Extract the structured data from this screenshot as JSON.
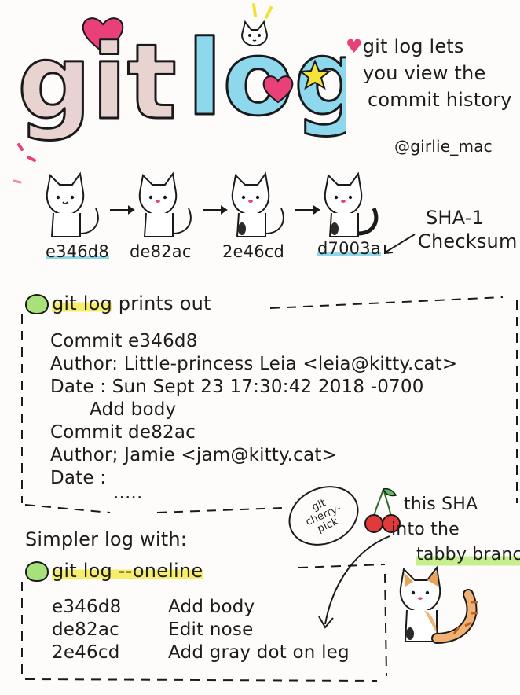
{
  "title": {
    "word1": "git",
    "word2": "log"
  },
  "intro": {
    "line1": "git log lets",
    "line2": "you view the",
    "line3": "commit history"
  },
  "author_handle": "@girlie_mac",
  "commits_row": {
    "shas": [
      "e346d8",
      "de82ac",
      "2e46cd",
      "d7003a"
    ],
    "checksum_label_line1": "SHA-1",
    "checksum_label_line2": "Checksum"
  },
  "full_log": {
    "header_command": "git log",
    "header_rest": "prints out",
    "lines": [
      "Commit e346d8",
      "Author: Little-princess Leia <leia@kitty.cat>",
      "Date : Sun Sept 23  17:30:42  2018 -0700",
      "Add body",
      "Commit de82ac",
      "Author; Jamie <jam@kitty.cat>",
      "Date   :",
      "....."
    ]
  },
  "cherry_pick": {
    "stamp_line1": "git",
    "stamp_line2": "cherry-",
    "stamp_line3": "pick",
    "note_line1": "this SHA",
    "note_line2": "into the",
    "note_line3": "tabby branch"
  },
  "oneline": {
    "intro": "Simpler log with:",
    "command": "git log --oneline",
    "entries": [
      {
        "sha": "e346d8",
        "message": "Add body"
      },
      {
        "sha": "de82ac",
        "message": "Edit nose"
      },
      {
        "sha": "2e46cd",
        "message": "Add gray dot on leg"
      }
    ]
  },
  "colors": {
    "git_letters": "#e8d3d0",
    "log_letters": "#8ed8ee",
    "heart": "#e9407a",
    "star": "#f5e33c",
    "highlight_yellow": "#f6ee6a",
    "highlight_teal": "#8fd7e6",
    "highlight_green": "#c8ef8d",
    "cherry": "#e23a3a"
  }
}
